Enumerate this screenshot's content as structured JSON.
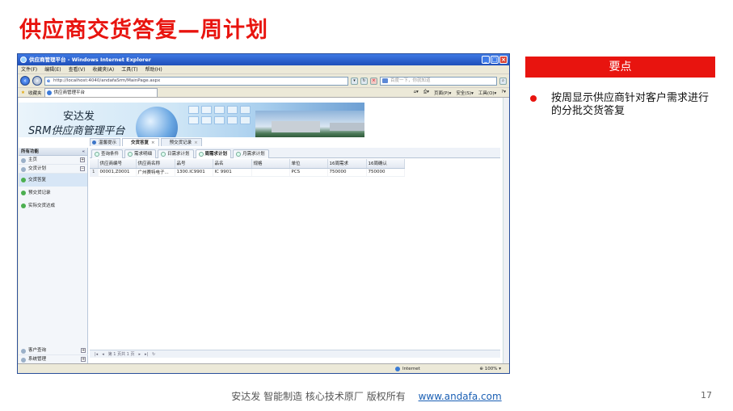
{
  "slide": {
    "title": "供应商交货答复—周计划",
    "key_points_heading": "要点",
    "key_point": "按周显示供应商针对客户需求进行的分批交货答复",
    "footer_text": "安达发   智能制造 核心技术原厂    版权所有",
    "footer_link": "www.andafa.com",
    "page_number": "17"
  },
  "browser": {
    "title": "供应商管理平台 - Windows Internet Explorer",
    "menu": [
      "文件(F)",
      "编辑(E)",
      "查看(V)",
      "收藏夹(A)",
      "工具(T)",
      "帮助(H)"
    ],
    "address": "http://localhost:4040/andafaSrm/MainPage.aspx",
    "search_placeholder": "百度一下，你就知道",
    "favorites_label": "收藏夹",
    "tab_title": "供应商管理平台",
    "toolbar_right": [
      "页面(P)▾",
      "安全(S)▾",
      "工具(O)▾"
    ],
    "status_zone": "Internet",
    "zoom": "100%"
  },
  "app": {
    "company": "安达发",
    "product": "SRM供应商管理平台",
    "top_tabs": [
      {
        "label": "温馨提示",
        "active": false
      },
      {
        "label": "交货答复",
        "active": true
      },
      {
        "label": "预交货记录",
        "active": false
      }
    ],
    "sub_tabs": [
      {
        "label": "查询条件",
        "active": false
      },
      {
        "label": "需求明细",
        "active": false
      },
      {
        "label": "日需求计划",
        "active": false
      },
      {
        "label": "周需求计划",
        "active": true
      },
      {
        "label": "月需求计划",
        "active": false
      }
    ],
    "nav": {
      "header": "所有功能",
      "collapse": "«",
      "items": [
        {
          "label": "主页",
          "toggle": "+"
        },
        {
          "label": "交货计划",
          "toggle": "−"
        }
      ],
      "sub_items": [
        "交货答复",
        "预交货记录",
        "实际交货达成"
      ],
      "bottom_items": [
        {
          "label": "客户查询",
          "toggle": "+"
        },
        {
          "label": "系统管理",
          "toggle": "+"
        }
      ]
    },
    "grid": {
      "columns": [
        "供应商编号",
        "供应商名称",
        "品号",
        "品名",
        "规格",
        "单位",
        "16周需求",
        "16周确认"
      ],
      "rows": [
        [
          "1",
          "00001,Z0001",
          "广州赛特电子...",
          "1300.IC9901",
          "IC 9901",
          "",
          "PCS",
          "750000",
          "750000"
        ]
      ]
    },
    "pager": "第 1 页共 1 页"
  }
}
